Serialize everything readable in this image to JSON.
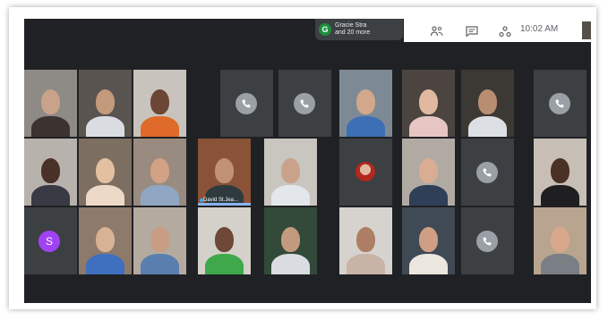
{
  "presentation": {
    "avatar_letter": "G",
    "line1": "Gracie Stra",
    "line2": "and 20 more"
  },
  "header": {
    "people_icon": "people-icon",
    "chat_icon": "chat-icon",
    "activities_icon": "activities-icon",
    "time": "10:02 AM"
  },
  "tiles": [
    {
      "kind": "person",
      "skin": "#c9a28a",
      "shirt": "#3a3330",
      "bg": "#8e8a86"
    },
    {
      "kind": "person",
      "skin": "#c49a7c",
      "shirt": "#d9dde2",
      "bg": "#5a5450"
    },
    {
      "kind": "person",
      "skin": "#6b4535",
      "shirt": "#e06a2a",
      "bg": "#c8c4bd"
    },
    {
      "kind": "call"
    },
    {
      "kind": "call"
    },
    {
      "kind": "person",
      "skin": "#d2a88c",
      "shirt": "#3d6fb5",
      "bg": "#7d8a95"
    },
    {
      "kind": "person",
      "skin": "#e0b9a0",
      "shirt": "#e6c6c2",
      "bg": "#4b4440"
    },
    {
      "kind": "person",
      "skin": "#b88d72",
      "shirt": "#dcdfe3",
      "bg": "#3c3834"
    },
    {
      "kind": "call"
    },
    {
      "kind": "person",
      "skin": "#4a3128",
      "shirt": "#3a3a44",
      "bg": "#b8b2ac"
    },
    {
      "kind": "person",
      "skin": "#e2c0a0",
      "shirt": "#ecd9c8",
      "bg": "#7d6e62"
    },
    {
      "kind": "person",
      "skin": "#d3a184",
      "shirt": "#8fa6c3",
      "bg": "#9a8b80"
    },
    {
      "kind": "person",
      "skin": "#c29277",
      "shirt": "#2e3a3e",
      "bg": "#8a5236",
      "name": "David St.Jea...",
      "speaking": true
    },
    {
      "kind": "person",
      "skin": "#caa28a",
      "shirt": "#e3e6ea",
      "bg": "#c9c5bf"
    },
    {
      "kind": "photo-avatar",
      "color": "#b3261e"
    },
    {
      "kind": "person",
      "skin": "#d8ad92",
      "shirt": "#2f3f58",
      "bg": "#b1aaa3"
    },
    {
      "kind": "call"
    },
    {
      "kind": "person",
      "skin": "#4b3024",
      "shirt": "#1f1f22",
      "bg": "#c7bfb5"
    },
    {
      "kind": "letter",
      "letter": "S",
      "color": "#a142f4"
    },
    {
      "kind": "person",
      "skin": "#d9b295",
      "shirt": "#3f6fbf",
      "bg": "#8d7a6a"
    },
    {
      "kind": "person",
      "skin": "#c89d83",
      "shirt": "#5a7fae",
      "bg": "#b4aaa0"
    },
    {
      "kind": "person",
      "skin": "#6d4837",
      "shirt": "#3ea84a",
      "bg": "#d4d0ca"
    },
    {
      "kind": "person",
      "skin": "#c39a7e",
      "shirt": "#d9dde2",
      "bg": "#324a3a"
    },
    {
      "kind": "person",
      "skin": "#ad7e63",
      "shirt": "#c8b3a7",
      "bg": "#d6d3cf"
    },
    {
      "kind": "person",
      "skin": "#cf9f84",
      "shirt": "#ebe6de",
      "bg": "#3f4a55"
    },
    {
      "kind": "call"
    },
    {
      "kind": "person",
      "skin": "#d8a88b",
      "shirt": "#7a7f86",
      "bg": "#b9a48f"
    }
  ]
}
